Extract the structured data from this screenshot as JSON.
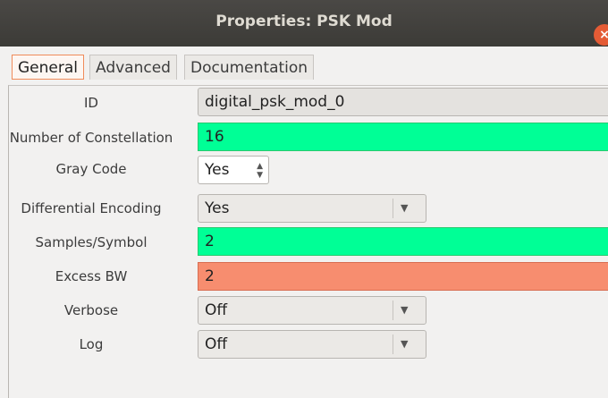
{
  "window": {
    "title": "Properties: PSK Mod",
    "close_glyph": "×"
  },
  "tabs": [
    {
      "label": "General",
      "active": true
    },
    {
      "label": "Advanced",
      "active": false
    },
    {
      "label": "Documentation",
      "active": false
    }
  ],
  "params": {
    "id": {
      "label": "ID",
      "value": "digital_psk_mod_0"
    },
    "constellation": {
      "label": "Number of Constellation",
      "value": "16"
    },
    "gray_code": {
      "label": "Gray Code",
      "value": "Yes"
    },
    "differential": {
      "label": "Differential Encoding",
      "value": "Yes"
    },
    "samples": {
      "label": "Samples/Symbol",
      "value": "2"
    },
    "excess_bw": {
      "label": "Excess BW",
      "value": "2"
    },
    "verbose": {
      "label": "Verbose",
      "value": "Off"
    },
    "log": {
      "label": "Log",
      "value": "Off"
    }
  },
  "icons": {
    "spin_up": "▲",
    "spin_down": "▼",
    "dropdown": "▼"
  },
  "colors": {
    "valid_bg": "#00ff96",
    "error_bg": "#f78d6f",
    "titlebar": "#3c3b37",
    "close": "#e45b35"
  }
}
